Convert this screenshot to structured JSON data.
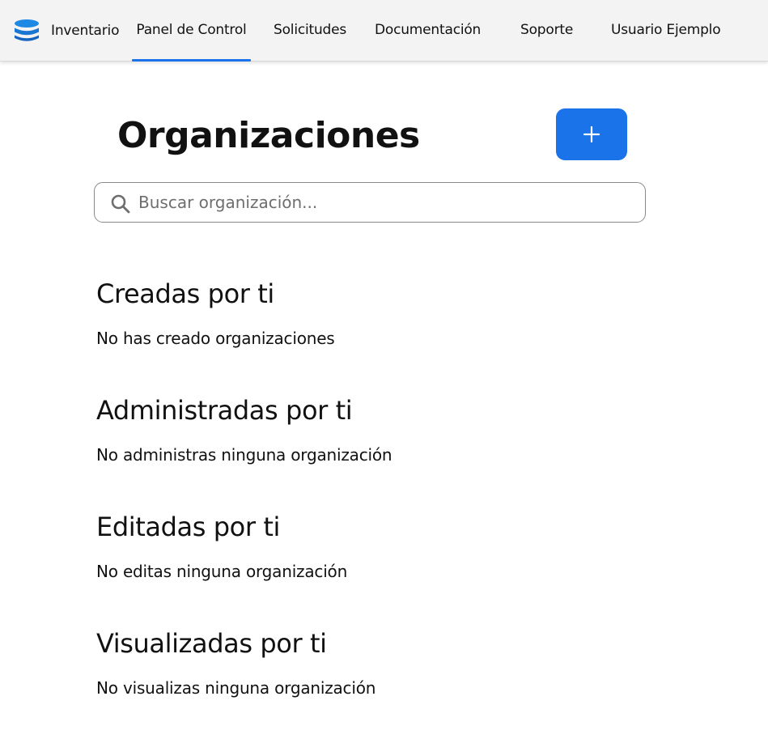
{
  "theme": {
    "accent": "#1a73e8",
    "navbar_bg": "#f3f3f3"
  },
  "navbar": {
    "brand": {
      "icon": "database-icon",
      "label": "Inventario"
    },
    "items": [
      {
        "label": "Panel de Control",
        "active": true
      },
      {
        "label": "Solicitudes",
        "active": false
      },
      {
        "label": "Documentación",
        "active": false
      },
      {
        "label": "Soporte",
        "active": false
      },
      {
        "label": "Usuario Ejemplo",
        "active": false
      }
    ]
  },
  "main": {
    "title": "Organizaciones",
    "add_button": {
      "icon": "plus-icon"
    },
    "search": {
      "icon": "search-icon",
      "placeholder": "Buscar organización...",
      "value": ""
    },
    "sections": [
      {
        "heading": "Creadas por ti",
        "empty_text": "No has creado organizaciones"
      },
      {
        "heading": "Administradas por ti",
        "empty_text": "No administras ninguna organización"
      },
      {
        "heading": "Editadas por ti",
        "empty_text": "No editas ninguna organización"
      },
      {
        "heading": "Visualizadas por ti",
        "empty_text": "No visualizas ninguna organización"
      }
    ]
  }
}
